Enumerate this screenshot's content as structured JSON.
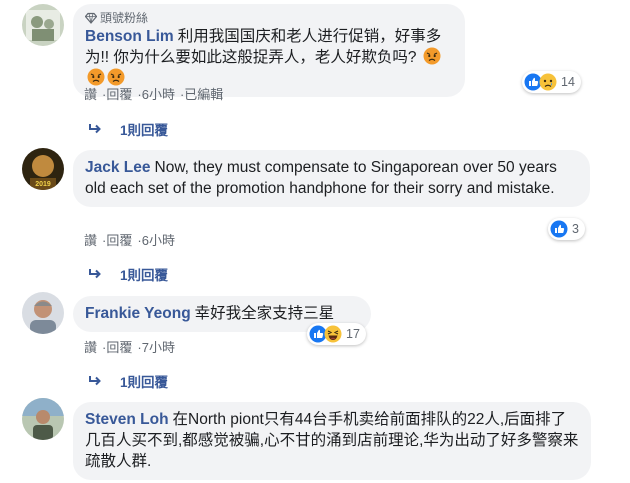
{
  "colors": {
    "link": "#385898",
    "bubble": "#f2f3f5",
    "meta": "#606770",
    "like": "#1877f2",
    "angry": "#e9710f"
  },
  "comments": [
    {
      "badge": "頭號粉絲",
      "author": "Benson Lim",
      "text": "利用我国国庆和老人进行促销，好事多为!! 你为什么要如此这般捉弄人，老人好欺负吗?",
      "emojis": [
        "angry-face-emoji",
        "angry-face-emoji",
        "angry-face-emoji"
      ],
      "reactions": {
        "icons": [
          "like-icon",
          "sad-icon"
        ],
        "count": "14"
      },
      "actions": {
        "like": "讚",
        "reply": "回覆",
        "time": "6小時",
        "edited": "已編輯"
      },
      "replies": "1則回覆"
    },
    {
      "author": "Jack Lee",
      "text": "Now, they must compensate to Singaporean over 50 years old each set of the promotion handphone for their sorry and mistake.",
      "reactions": {
        "icons": [
          "like-icon"
        ],
        "count": "3"
      },
      "actions": {
        "like": "讚",
        "reply": "回覆",
        "time": "6小時"
      },
      "replies": "1則回覆"
    },
    {
      "author": "Frankie Yeong",
      "text": "幸好我全家支持三星",
      "reactions": {
        "icons": [
          "like-icon",
          "haha-icon"
        ],
        "count": "17"
      },
      "actions": {
        "like": "讚",
        "reply": "回覆",
        "time": "7小時"
      },
      "replies": "1則回覆"
    },
    {
      "author": "Steven Loh",
      "text": "在North piont只有44台手机卖给前面排队的22人,后面排了几百人买不到,都感觉被骗,心不甘的涌到店前理论,华为出动了好多警察来疏散人群."
    }
  ]
}
